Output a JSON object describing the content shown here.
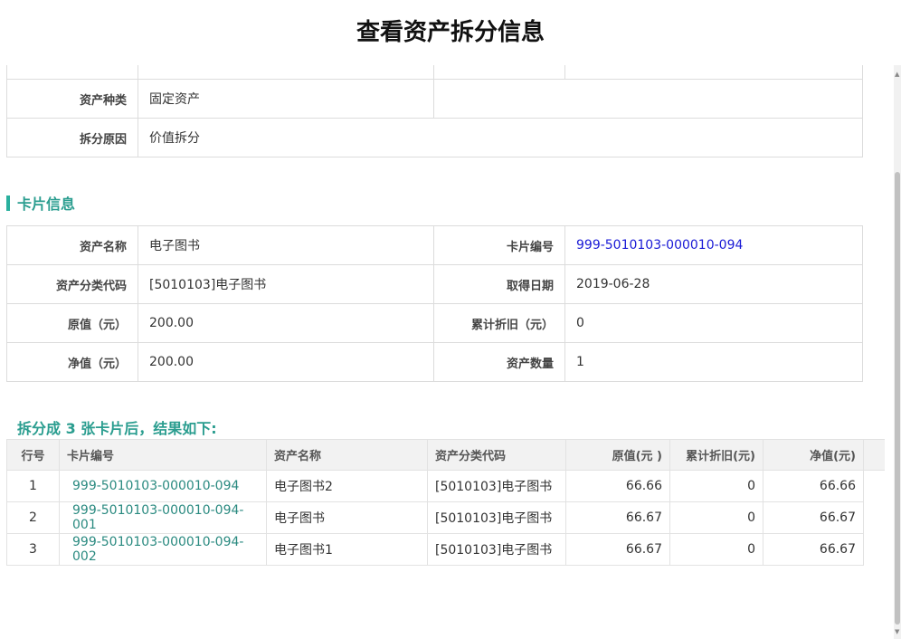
{
  "page": {
    "title": "查看资产拆分信息"
  },
  "basic": {
    "rows": [
      {
        "label": "资产种类",
        "value": "固定资产"
      },
      {
        "label": "拆分原因",
        "value": "价值拆分"
      }
    ]
  },
  "card_section": {
    "heading": "卡片信息",
    "rows": [
      {
        "l1": "资产名称",
        "v1": "电子图书",
        "l2": "卡片编号",
        "v2": "999-5010103-000010-094"
      },
      {
        "l1": "资产分类代码",
        "v1": "[5010103]电子图书",
        "l2": "取得日期",
        "v2": "2019-06-28"
      },
      {
        "l1": "原值（元）",
        "v1": "200.00",
        "l2": "累计折旧（元）",
        "v2": "0"
      },
      {
        "l1": "净值（元）",
        "v1": "200.00",
        "l2": "资产数量",
        "v2": "1"
      }
    ]
  },
  "result": {
    "title": "拆分成 3 张卡片后，结果如下:",
    "columns": [
      "行号",
      "卡片编号",
      "资产名称",
      "资产分类代码",
      "原值(元 )",
      "累计折旧(元)",
      "净值(元)"
    ],
    "rows": [
      {
        "no": "1",
        "card": "999-5010103-000010-094",
        "name": "电子图书2",
        "code": "[5010103]电子图书",
        "orig": "66.66",
        "dep": "0",
        "net": "66.66"
      },
      {
        "no": "2",
        "card": "999-5010103-000010-094-001",
        "name": "电子图书",
        "code": "[5010103]电子图书",
        "orig": "66.67",
        "dep": "0",
        "net": "66.67"
      },
      {
        "no": "3",
        "card": "999-5010103-000010-094-002",
        "name": "电子图书1",
        "code": "[5010103]电子图书",
        "orig": "66.67",
        "dep": "0",
        "net": "66.67"
      }
    ]
  }
}
